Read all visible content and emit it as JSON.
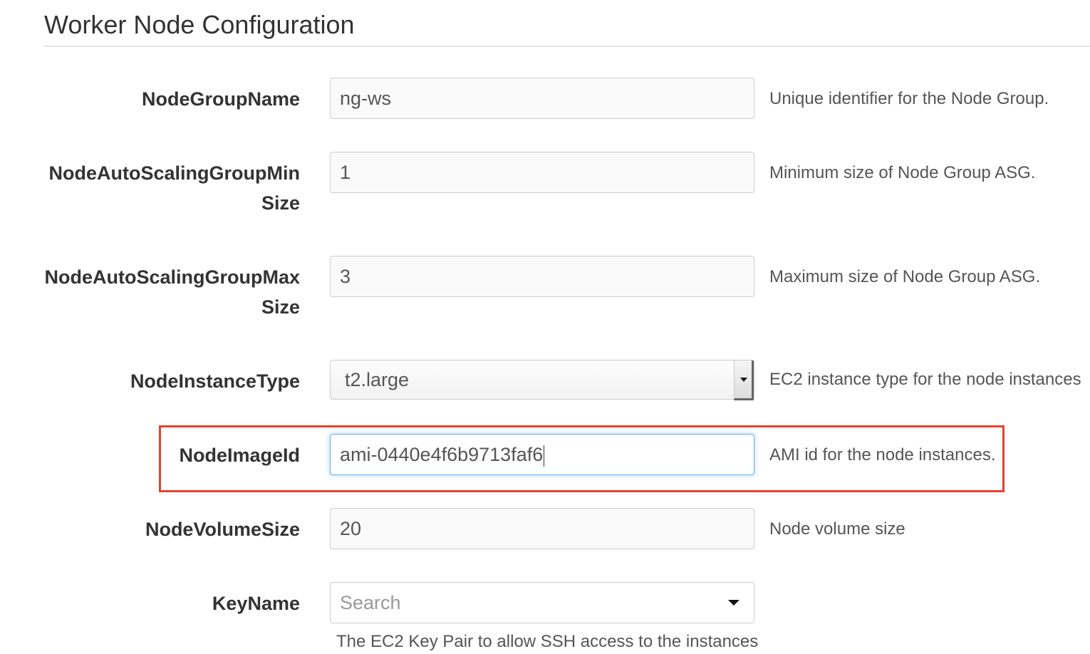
{
  "section_title": "Worker Node Configuration",
  "fields": [
    {
      "label": "NodeGroupName",
      "value": "ng-ws",
      "help": "Unique identifier for the Node Group."
    },
    {
      "label": "NodeAutoScalingGroupMinSize",
      "value": "1",
      "help": "Minimum size of Node Group ASG."
    },
    {
      "label": "NodeAutoScalingGroupMaxSize",
      "value": "3",
      "help": "Maximum size of Node Group ASG."
    },
    {
      "label": "NodeInstanceType",
      "value": "t2.large",
      "help": "EC2 instance type for the node instances"
    },
    {
      "label": "NodeImageId",
      "value": "ami-0440e4f6b9713faf6",
      "help": "AMI id for the node instances."
    },
    {
      "label": "NodeVolumeSize",
      "value": "20",
      "help": "Node volume size"
    },
    {
      "label": "KeyName",
      "placeholder": "Search",
      "help": "The EC2 Key Pair to allow SSH access to the instances"
    }
  ],
  "highlight_color": "#e8412c"
}
